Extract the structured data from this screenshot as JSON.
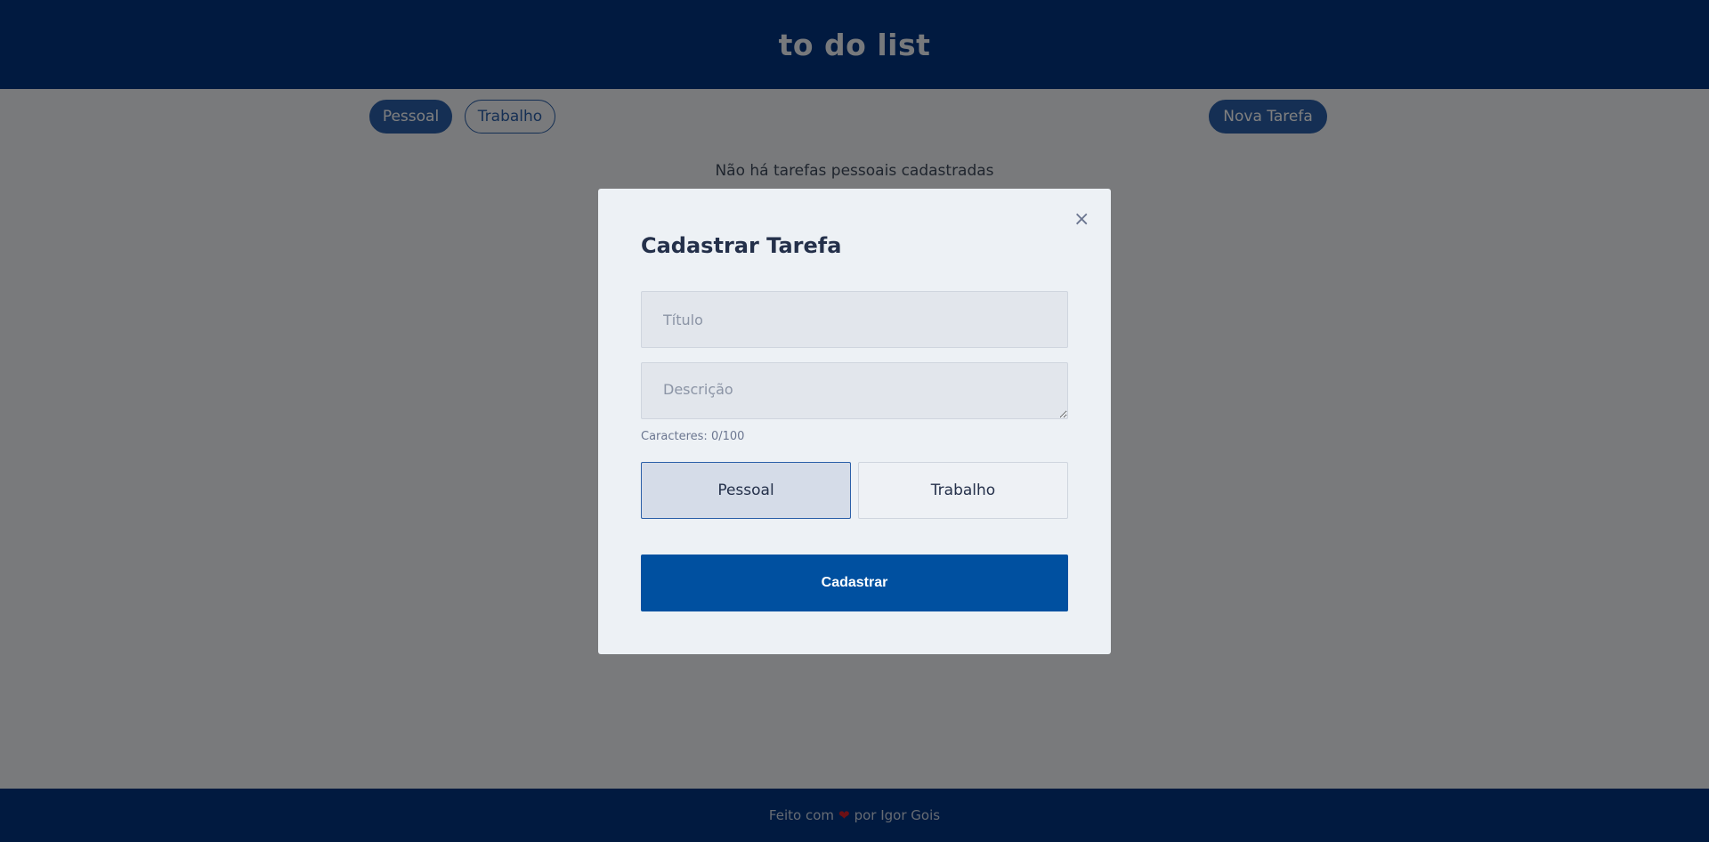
{
  "header": {
    "title": "to do list"
  },
  "toolbar": {
    "filters": [
      {
        "label": "Pessoal",
        "active": true
      },
      {
        "label": "Trabalho",
        "active": false
      }
    ],
    "new_task_label": "Nova Tarefa"
  },
  "main": {
    "empty_message": "Não há tarefas pessoais cadastradas"
  },
  "footer": {
    "text_before": "Feito com",
    "heart": "❤",
    "text_after": "por Igor Gois"
  },
  "modal": {
    "title": "Cadastrar Tarefa",
    "close_symbol": "×",
    "title_placeholder": "Título",
    "title_value": "",
    "description_placeholder": "Descrição",
    "description_value": "",
    "char_count": "Caracteres: 0/100",
    "types": [
      {
        "label": "Pessoal",
        "selected": true
      },
      {
        "label": "Trabalho",
        "selected": false
      }
    ],
    "submit_label": "Cadastrar"
  },
  "colors": {
    "brand": "#023480",
    "accent": "#2b5fa8",
    "submit": "#0050a0",
    "heart": "#d8202a"
  }
}
